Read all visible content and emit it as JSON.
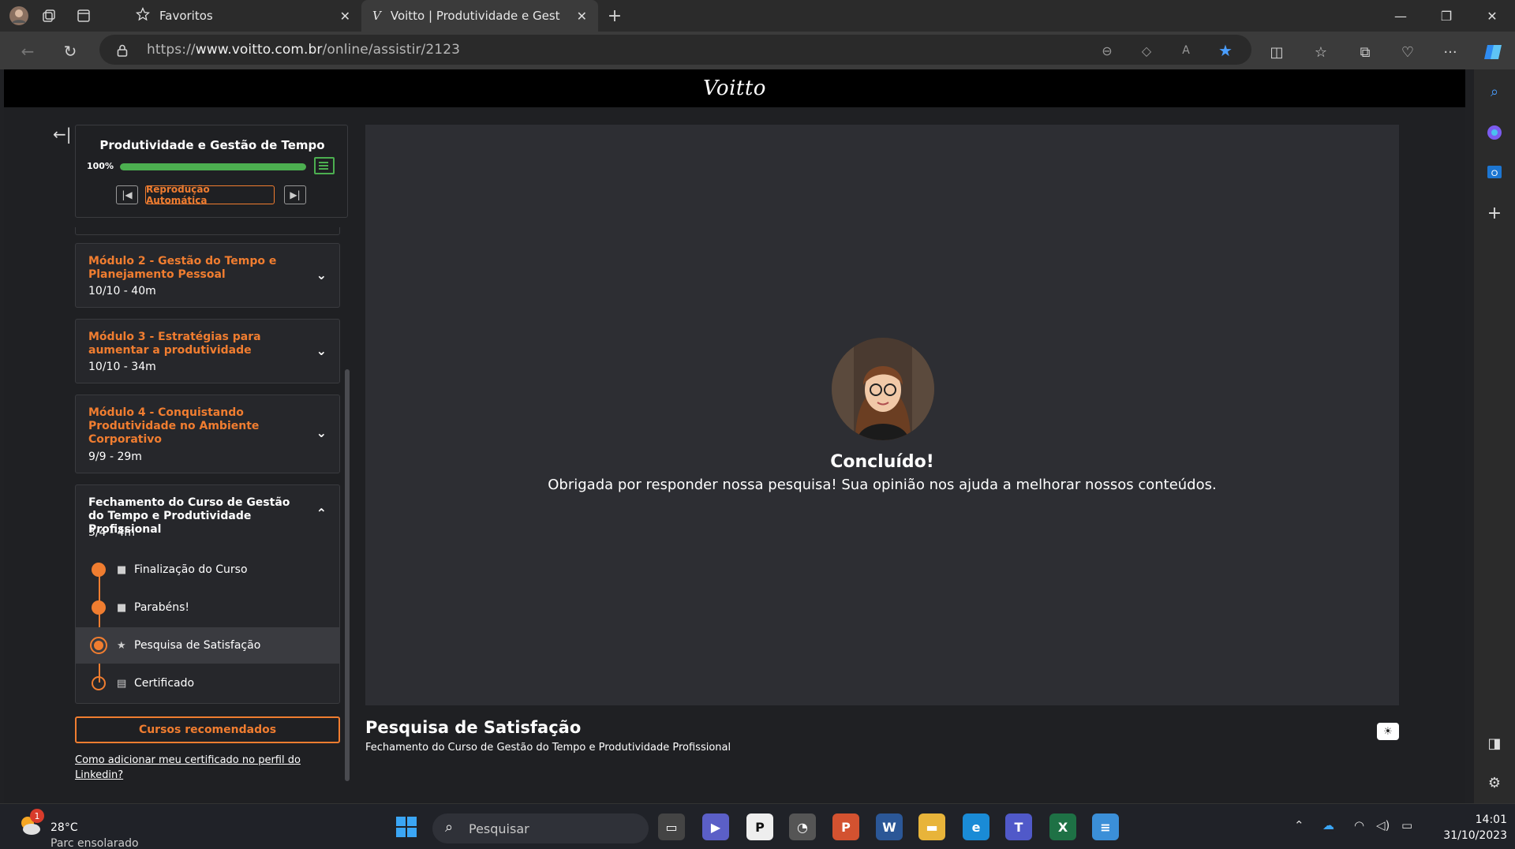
{
  "browser": {
    "tabs": [
      {
        "label": "Favoritos"
      },
      {
        "label": "Voitto | Produtividade e Gestão do Tempo"
      }
    ],
    "url_prefix": "https://",
    "url_domain": "www.voitto.com.br",
    "url_path": "/online/assistir/2123"
  },
  "site": {
    "logo": "Voitto"
  },
  "course": {
    "title": "Produtividade e Gestão de Tempo",
    "progress_label": "100%",
    "progress_value": 1.0,
    "autoplay_label": "Reprodução Automática"
  },
  "modules": [
    {
      "title": "Módulo 2 - Gestão do Tempo e Planejamento Pessoal",
      "meta": "10/10  -  40m"
    },
    {
      "title": "Módulo 3 - Estratégias para aumentar a produtividade",
      "meta": "10/10  -  34m"
    },
    {
      "title": "Módulo 4 - Conquistando Produtividade no Ambiente Corporativo",
      "meta": "9/9  -  29m"
    },
    {
      "title": "Fechamento do Curso de Gestão do Tempo e Produtividade Profissional",
      "meta": "3/4  -  4m"
    }
  ],
  "lessons": [
    {
      "label": "Finalização do Curso",
      "icon": "video-icon"
    },
    {
      "label": "Parabéns!",
      "icon": "video-icon"
    },
    {
      "label": "Pesquisa de Satisfação",
      "icon": "star-icon"
    },
    {
      "label": "Certificado",
      "icon": "document-icon"
    }
  ],
  "sidebar_footer": {
    "recommended_label": "Cursos recomendados",
    "linkedin_link": "Como adicionar meu certificado no perfil do Linkedin?"
  },
  "main": {
    "done_title": "Concluído!",
    "done_message": "Obrigada por responder nossa pesquisa! Sua opinião nos ajuda a melhorar nossos conteúdos.",
    "lesson_title": "Pesquisa de Satisfação",
    "lesson_subtitle": "Fechamento do Curso de Gestão do Tempo e Produtividade Profissional"
  },
  "taskbar": {
    "weather_badge": "1",
    "weather_temp": "28°C",
    "weather_desc": "Parc ensolarado",
    "search_placeholder": "Pesquisar",
    "time": "14:01",
    "date": "31/10/2023"
  },
  "colors": {
    "accent": "#f07d30",
    "progress": "#4caf50",
    "page_bg": "#1f2023"
  }
}
